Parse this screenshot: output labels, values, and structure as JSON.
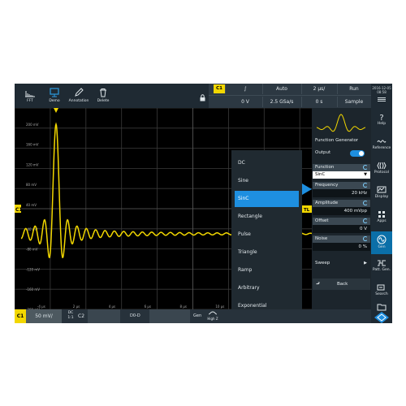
{
  "toolbar": {
    "items": [
      {
        "label": "FFT"
      },
      {
        "label": "Demo"
      },
      {
        "label": "Annotation"
      },
      {
        "label": "Delete"
      }
    ]
  },
  "acquisition": {
    "channel_tag": "C1",
    "coupling_symbol": "∫",
    "trigger_mode": "Auto",
    "time_per_div": "2 µs/",
    "run_state": "Run",
    "trigger_level": "0 V",
    "sample_rate": "2.5 GSa/s",
    "time_offset": "0 s",
    "acq_mode": "Sample"
  },
  "datetime": {
    "date": "2016-12-05",
    "time": "08:58"
  },
  "sidebar": {
    "items": [
      {
        "label": "Help",
        "icon": "help-icon"
      },
      {
        "label": "Reference",
        "icon": "reference-icon"
      },
      {
        "label": "Protocol",
        "icon": "protocol-icon"
      },
      {
        "label": "Display",
        "icon": "display-icon"
      },
      {
        "label": "Apps",
        "icon": "apps-icon"
      },
      {
        "label": "Gen",
        "icon": "gen-icon",
        "active": true
      },
      {
        "label": "Patt. Gen.",
        "icon": "pattern-gen-icon"
      },
      {
        "label": "Search",
        "icon": "search-icon"
      }
    ]
  },
  "grid_labels": {
    "y_ticks": [
      "200 mV",
      "160 mV",
      "120 mV",
      "80 mV",
      "40 mV",
      "-40 mV",
      "-80 mV",
      "-120 mV",
      "-160 mV",
      "-200 mV"
    ],
    "x_ticks": [
      "-4 µs",
      "2 µs",
      "4 µs",
      "6 µs",
      "8 µs",
      "10 µs",
      "12 µs",
      "14 µs",
      "16 µs",
      "18 µs"
    ],
    "left_marker": "C1",
    "right_marker": "TL"
  },
  "generator": {
    "title": "Function Generator",
    "output_label": "Output",
    "function_label": "Function",
    "function_value": "SinC",
    "frequency_label": "Frequency",
    "frequency_value": "20 kHz",
    "amplitude_label": "Amplitude",
    "amplitude_value": "400 mVpp",
    "offset_label": "Offset",
    "offset_value": "0 V",
    "noise_label": "Noise",
    "noise_value": "0 %",
    "sweep_label": "Sweep",
    "back_label": "Back"
  },
  "menu": {
    "items": [
      "DC",
      "Sine",
      "SinC",
      "Rectangle",
      "Pulse",
      "Triangle",
      "Ramp",
      "Arbitrary",
      "Exponential"
    ],
    "selected": "SinC"
  },
  "bottom": {
    "channel": "C1",
    "scale": "50 mV/",
    "coupling": "DC",
    "coupling_sub": "1:1",
    "c2": "C2",
    "digital": "D0-D",
    "gen": "Gen",
    "gen_mode": "High Z"
  },
  "colors": {
    "trace": "#f2d700",
    "accent": "#1e8fe0",
    "background": "#000000"
  }
}
